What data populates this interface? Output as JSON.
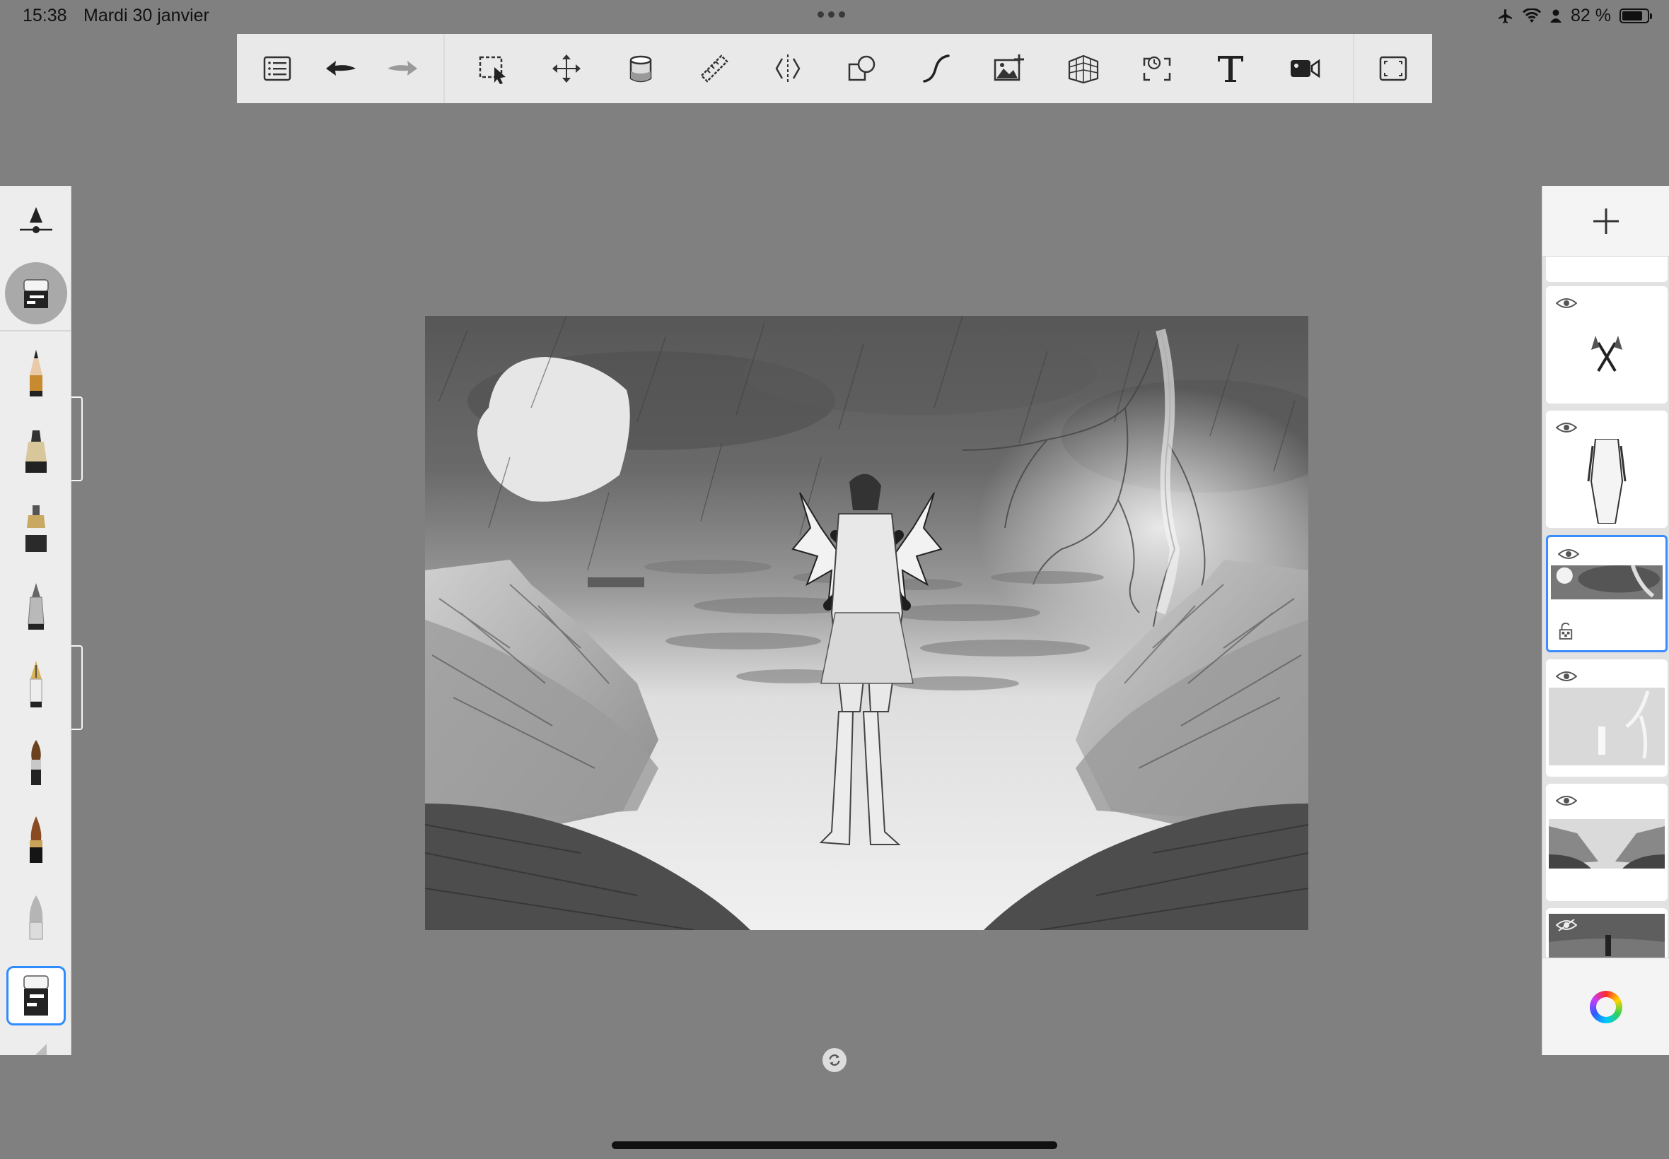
{
  "status": {
    "time": "15:38",
    "date": "Mardi 30 janvier",
    "battery": "82 %",
    "battery_level": 0.82,
    "icons": [
      "airplane-icon",
      "wifi-icon",
      "person-icon",
      "battery-icon"
    ]
  },
  "toolbar": {
    "left_tools": [
      "list-icon",
      "undo-icon",
      "redo-icon"
    ],
    "tools": [
      "selection-icon",
      "transform-icon",
      "fill-icon",
      "ruler-icon",
      "symmetry-icon",
      "shapes-icon",
      "stroke-icon",
      "import-image-icon",
      "perspective-icon",
      "time-lapse-icon",
      "text-icon",
      "video-icon"
    ],
    "right_tools": [
      "fullscreen-icon"
    ]
  },
  "brushes": {
    "selected_index": 8,
    "items": [
      "pencil-brush",
      "marker-brush",
      "airbrush-brush",
      "ballpoint-brush",
      "fountain-pen-brush",
      "paintbrush-brush",
      "ink-brush",
      "smudge-brush",
      "eraser-brush",
      "hard-eraser-brush"
    ],
    "colors": {
      "selection": "#2f8cff",
      "panel": "#ededed"
    }
  },
  "layers": {
    "selected_index": 2,
    "items": [
      "layer-figure-swords",
      "layer-figure-sketch",
      "layer-sky-moon",
      "layer-lightning",
      "layer-landscape",
      "layer-composite"
    ],
    "hidden_index": 5
  },
  "colors": {
    "background": "#808080",
    "toolbar": "#e9e9e9",
    "accent": "#3b8dff"
  }
}
